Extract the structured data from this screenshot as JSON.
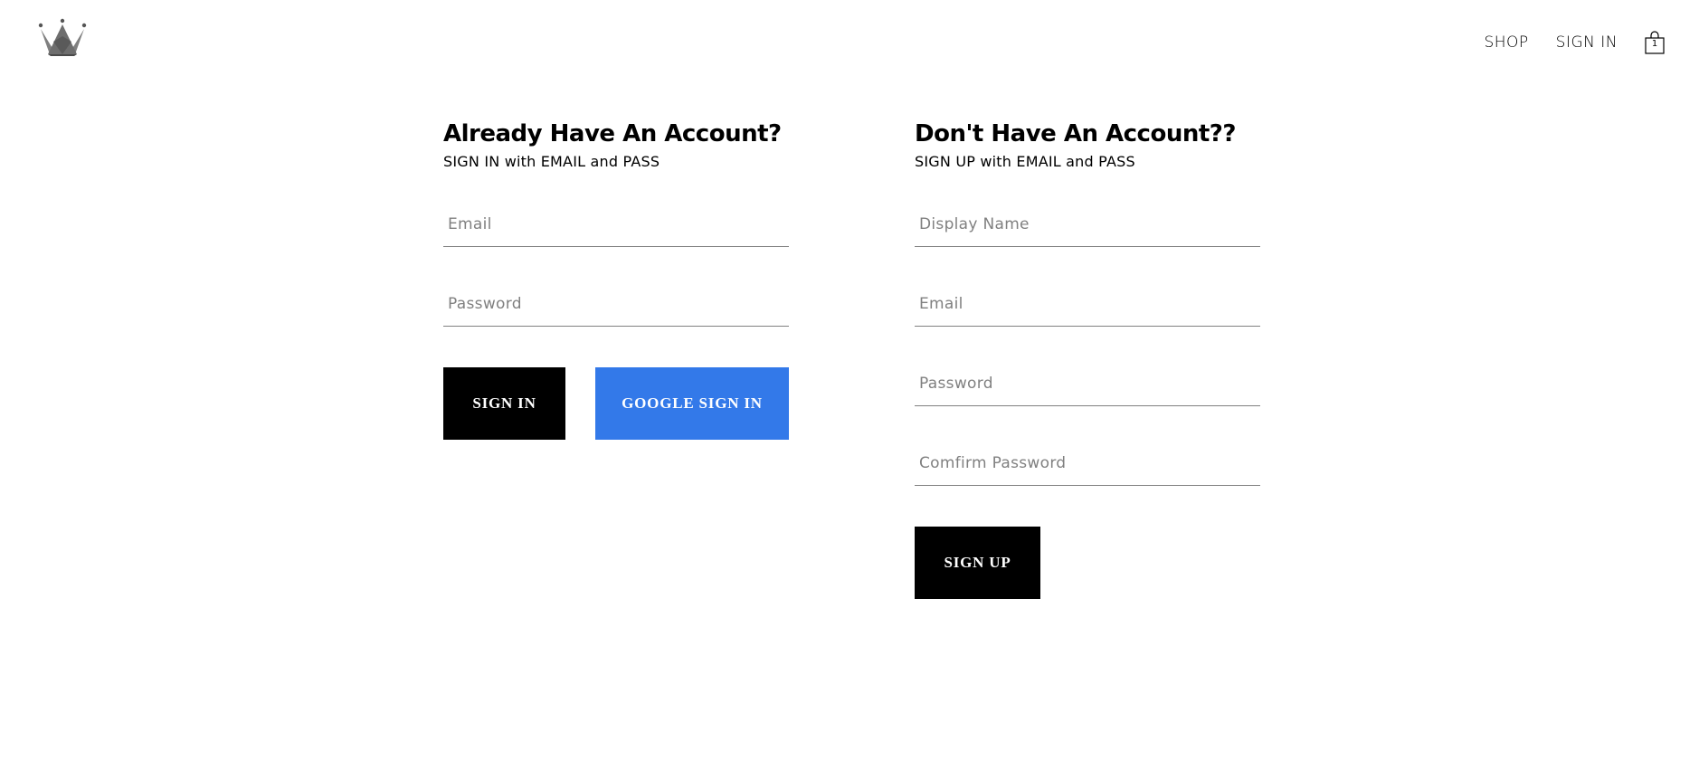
{
  "header": {
    "logo_icon": "crown-icon",
    "nav": {
      "shop_label": "SHOP",
      "signin_label": "SIGN IN"
    },
    "cart": {
      "icon": "shopping-bag-icon",
      "count": "1"
    }
  },
  "sign_in": {
    "title": "Already Have An Account?",
    "subtitle": "SIGN IN with EMAIL and PASS",
    "email_placeholder": "Email",
    "password_placeholder": "Password",
    "sign_in_button": "SIGN IN",
    "google_button": "GOOGLE SIGN IN"
  },
  "sign_up": {
    "title": "Don't Have An Account??",
    "subtitle": "SIGN UP with EMAIL and PASS",
    "display_name_placeholder": "Display Name",
    "email_placeholder": "Email",
    "password_placeholder": "Password",
    "confirm_password_placeholder": "Comfirm Password",
    "sign_up_button": "SIGN UP"
  },
  "colors": {
    "google_blue": "#3379e9",
    "dark_button": "#000000",
    "underline": "#808080"
  }
}
